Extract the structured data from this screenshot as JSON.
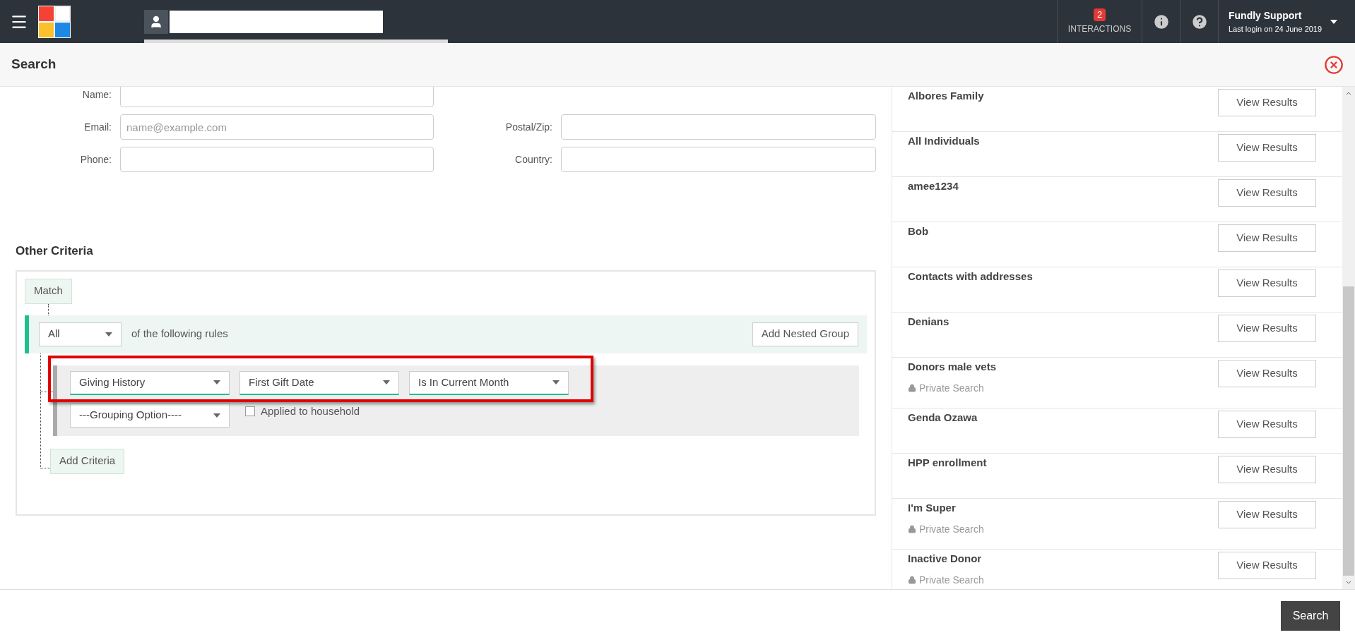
{
  "header": {
    "interactions": {
      "count": "2",
      "label": "INTERACTIONS"
    },
    "user": {
      "name": "Fundly Support",
      "last_login": "Last login on 24 June 2019"
    }
  },
  "title": "Search",
  "form": {
    "left": [
      {
        "label": "Name:"
      },
      {
        "label": "Email:",
        "placeholder": "name@example.com"
      },
      {
        "label": "Phone:"
      }
    ],
    "right": [
      {
        "label": "Postal/Zip:"
      },
      {
        "label": "Country:"
      }
    ]
  },
  "criteria": {
    "heading": "Other Criteria",
    "match_button": "Match",
    "group": {
      "operator": "All",
      "text": "of the following rules",
      "add_nested": "Add Nested Group"
    },
    "rule": {
      "selects": [
        "Giving History",
        "First Gift Date",
        "Is In Current Month"
      ],
      "highlighted": true,
      "grouping": "---Grouping Option----",
      "household": {
        "label": "Applied to household",
        "checked": false
      }
    },
    "add_criteria": "Add Criteria"
  },
  "saved_searches": [
    {
      "name": "Albores Family",
      "private": false,
      "button": "View Results"
    },
    {
      "name": "All Individuals",
      "private": false,
      "button": "View Results"
    },
    {
      "name": "amee1234",
      "private": false,
      "button": "View Results"
    },
    {
      "name": "Bob",
      "private": false,
      "button": "View Results"
    },
    {
      "name": "Contacts with addresses",
      "private": false,
      "button": "View Results"
    },
    {
      "name": "Denians",
      "private": false,
      "button": "View Results"
    },
    {
      "name": "Donors male vets",
      "private": true,
      "private_label": "Private Search",
      "button": "View Results"
    },
    {
      "name": "Genda Ozawa",
      "private": false,
      "button": "View Results"
    },
    {
      "name": "HPP enrollment",
      "private": false,
      "button": "View Results"
    },
    {
      "name": "I'm Super",
      "private": true,
      "private_label": "Private Search",
      "button": "View Results"
    },
    {
      "name": "Inactive Donor",
      "private": true,
      "private_label": "Private Search",
      "button": "View Results"
    }
  ],
  "search_button": "Search"
}
